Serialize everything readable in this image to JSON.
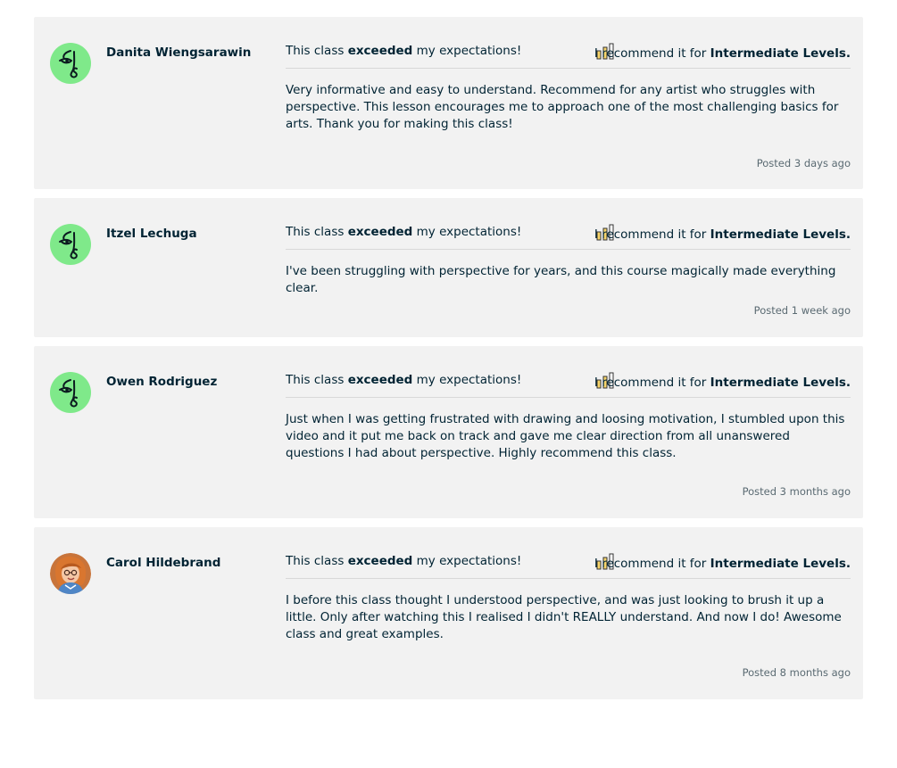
{
  "reviews": [
    {
      "name": "Danita Wiengsarawin",
      "avatar": "default-face-avatar",
      "expect_prefix": "This class ",
      "expect_bold": "exceeded",
      "expect_suffix": " my expectations!",
      "level_prefix": "I recommend it for ",
      "level_bold": "Intermediate Levels.",
      "text": "Very informative and easy to understand. Recommend for any artist who struggles with perspective. This lesson encourages me to approach one of the most challenging basics for arts. Thank you for making this class!",
      "posted": "Posted 3 days ago"
    },
    {
      "name": "Itzel Lechuga",
      "avatar": "default-face-avatar",
      "expect_prefix": "This class ",
      "expect_bold": "exceeded",
      "expect_suffix": " my expectations!",
      "level_prefix": "I recommend it for ",
      "level_bold": "Intermediate Levels.",
      "text": "I've been struggling with perspective for years, and this course magically made everything clear.",
      "posted": "Posted 1 week ago"
    },
    {
      "name": "Owen Rodriguez",
      "avatar": "default-face-avatar",
      "expect_prefix": "This class ",
      "expect_bold": "exceeded",
      "expect_suffix": " my expectations!",
      "level_prefix": "I recommend it for ",
      "level_bold": "Intermediate Levels.",
      "text": "Just when I was getting frustrated with drawing and loosing motivation, I stumbled upon this video and it put me back on track and gave me clear direction from all unanswered questions I had about perspective. Highly recommend this class.",
      "posted": "Posted 3 months ago"
    },
    {
      "name": "Carol Hildebrand",
      "avatar": "photo-avatar",
      "expect_prefix": "This class ",
      "expect_bold": "exceeded",
      "expect_suffix": " my expectations!",
      "level_prefix": "I recommend it for ",
      "level_bold": "Intermediate Levels.",
      "text": "I before this class thought I understood perspective, and was just looking to brush it up a little. Only after watching this I realised I didn't REALLY understand. And now I do! Awesome class and great examples.",
      "posted": "Posted 8 months ago"
    }
  ],
  "colors": {
    "card_bg": "#f2f2f2",
    "avatar_green": "#7fe98a",
    "level_bar_fill": "#f7d56b",
    "text_dark": "#002333"
  }
}
